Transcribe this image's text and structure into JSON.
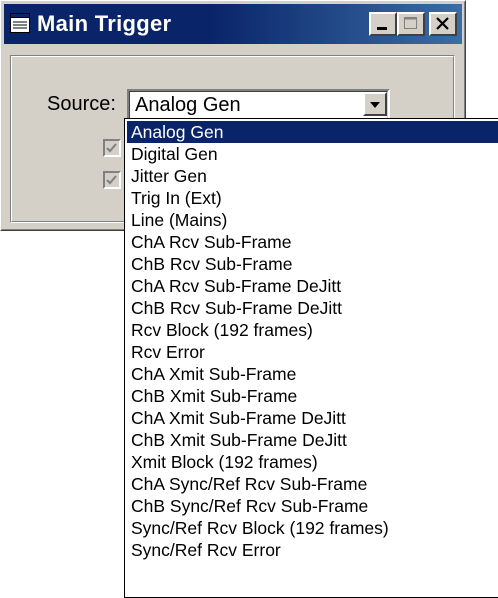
{
  "window": {
    "title": "Main Trigger",
    "buttons": {
      "minimize": "minimize-icon",
      "maximize": "maximize-icon",
      "close": "close-icon"
    }
  },
  "source": {
    "label": "Source:",
    "selected": "Analog Gen",
    "options": [
      "Analog Gen",
      "Digital Gen",
      "Jitter Gen",
      "Trig In (Ext)",
      "Line (Mains)",
      "ChA Rcv Sub-Frame",
      "ChB Rcv Sub-Frame",
      "ChA Rcv Sub-Frame DeJitt",
      "ChB Rcv Sub-Frame DeJitt",
      "Rcv Block (192 frames)",
      "Rcv Error",
      "ChA Xmit Sub-Frame",
      "ChB Xmit Sub-Frame",
      "ChA Xmit Sub-Frame DeJitt",
      "ChB Xmit Sub-Frame DeJitt",
      "Xmit Block (192 frames)",
      "ChA Sync/Ref Rcv Sub-Frame",
      "ChB Sync/Ref Rcv Sub-Frame",
      "Sync/Ref Rcv Block (192 frames)",
      "Sync/Ref Rcv Error"
    ]
  },
  "checkboxes": [
    {
      "checked": true,
      "enabled": false
    },
    {
      "checked": true,
      "enabled": false
    }
  ],
  "colors": {
    "face": "#d4d0c8",
    "title_bar": "#0a246a",
    "selection": "#0a246a"
  }
}
